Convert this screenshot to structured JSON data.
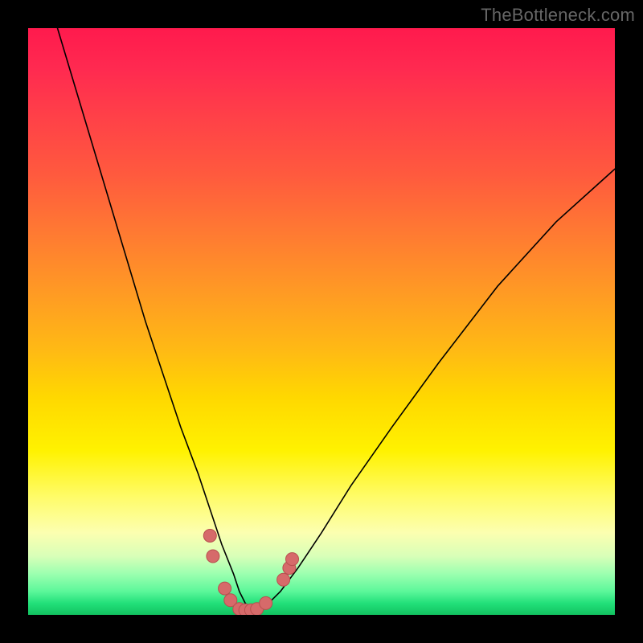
{
  "watermark": "TheBottleneck.com",
  "colors": {
    "page_bg": "#000000",
    "gradient_top": "#ff1a4d",
    "gradient_bottom": "#12c260",
    "curve_stroke": "#000000",
    "dot_fill": "#d66a6a",
    "dot_stroke": "#b84f4f"
  },
  "chart_data": {
    "type": "line",
    "title": "",
    "xlabel": "",
    "ylabel": "",
    "xlim": [
      0,
      100
    ],
    "ylim": [
      0,
      100
    ],
    "grid": false,
    "legend": false,
    "note": "Axes have no labels or ticks in the image; plot area is a square inset on a black frame with a vertical red→yellow→green gradient. A thin black V-curve descends from top-left to a rounded minimum near x≈37 then rises to the right. Salmon dots cluster near the minimum.",
    "series": [
      {
        "name": "curve",
        "x": [
          5,
          8,
          11,
          14,
          17,
          20,
          23,
          26,
          29,
          31,
          33,
          35,
          36,
          37,
          38,
          39,
          41,
          43,
          46,
          50,
          55,
          62,
          70,
          80,
          90,
          100
        ],
        "y": [
          100,
          90,
          80,
          70,
          60,
          50,
          41,
          32,
          24,
          18,
          12,
          7,
          4,
          2,
          1,
          1,
          2,
          4,
          8,
          14,
          22,
          32,
          43,
          56,
          67,
          76
        ]
      }
    ],
    "points": [
      {
        "name": "dot",
        "x": 31.0,
        "y": 13.5
      },
      {
        "name": "dot",
        "x": 31.5,
        "y": 10.0
      },
      {
        "name": "dot",
        "x": 33.5,
        "y": 4.5
      },
      {
        "name": "dot",
        "x": 34.5,
        "y": 2.5
      },
      {
        "name": "dot",
        "x": 36.0,
        "y": 1.0
      },
      {
        "name": "dot",
        "x": 37.0,
        "y": 0.8
      },
      {
        "name": "dot",
        "x": 38.0,
        "y": 0.8
      },
      {
        "name": "dot",
        "x": 39.0,
        "y": 1.0
      },
      {
        "name": "dot",
        "x": 40.5,
        "y": 2.0
      },
      {
        "name": "dot",
        "x": 43.5,
        "y": 6.0
      },
      {
        "name": "dot",
        "x": 44.5,
        "y": 8.0
      },
      {
        "name": "dot",
        "x": 45.0,
        "y": 9.5
      }
    ]
  }
}
